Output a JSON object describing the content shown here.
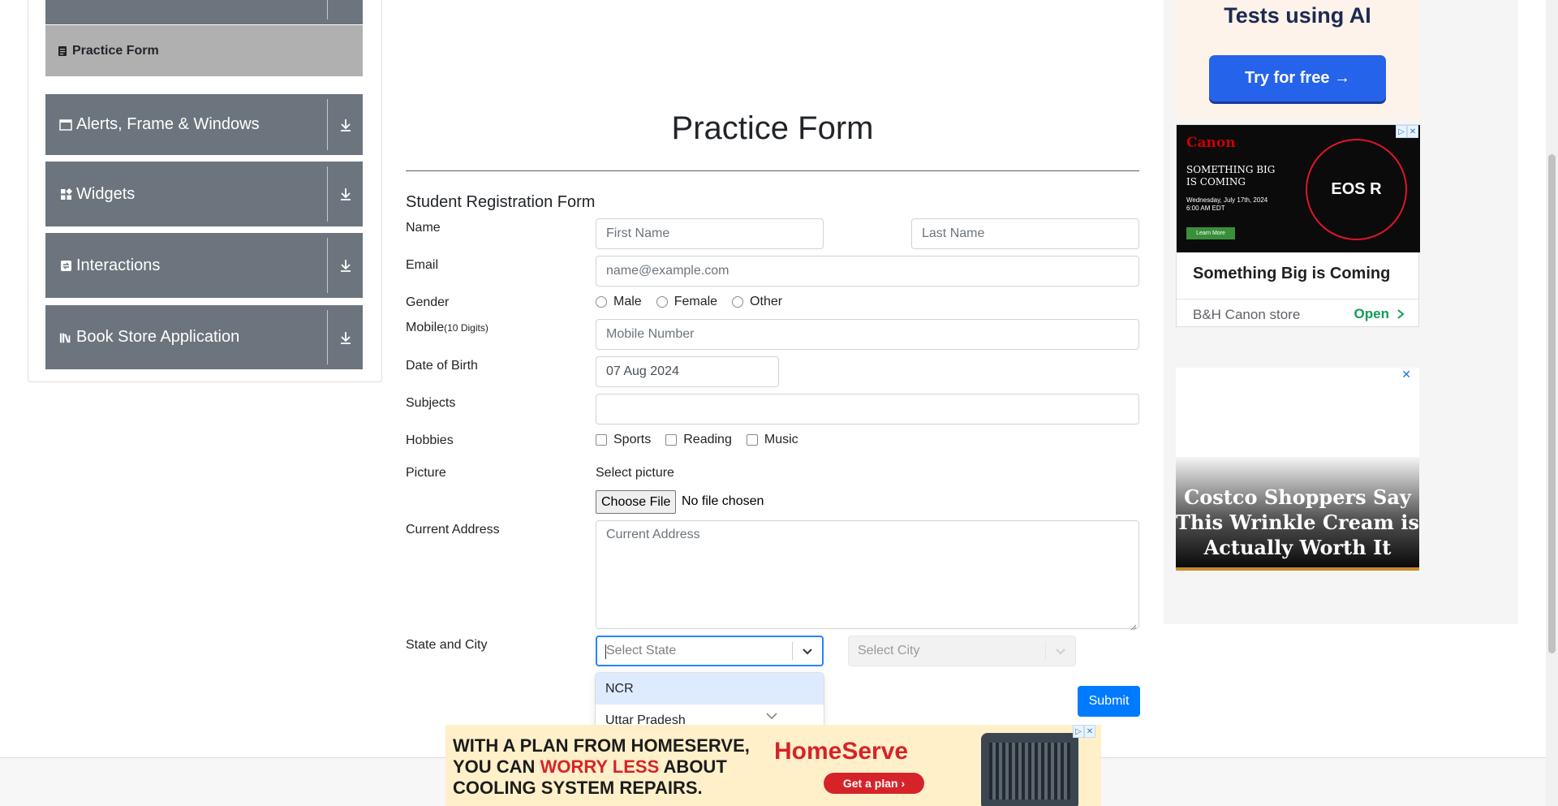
{
  "sidebar": {
    "active_item": {
      "label": "Practice Form",
      "icon": "form-icon"
    },
    "groups": [
      {
        "label": "Alerts, Frame & Windows",
        "icon": "window-icon"
      },
      {
        "label": "Widgets",
        "icon": "widgets-icon"
      },
      {
        "label": "Interactions",
        "icon": "interactions-icon"
      },
      {
        "label": "Book Store Application",
        "icon": "books-icon"
      }
    ]
  },
  "form": {
    "page_title": "Practice Form",
    "subtitle": "Student Registration Form",
    "name": {
      "label": "Name",
      "first_placeholder": "First Name",
      "last_placeholder": "Last Name"
    },
    "email": {
      "label": "Email",
      "placeholder": "name@example.com"
    },
    "gender": {
      "label": "Gender",
      "options": [
        "Male",
        "Female",
        "Other"
      ]
    },
    "mobile": {
      "label": "Mobile",
      "hint": "(10 Digits)",
      "placeholder": "Mobile Number"
    },
    "dob": {
      "label": "Date of Birth",
      "value": "07 Aug 2024"
    },
    "subjects": {
      "label": "Subjects",
      "value": ""
    },
    "hobbies": {
      "label": "Hobbies",
      "options": [
        "Sports",
        "Reading",
        "Music"
      ]
    },
    "picture": {
      "label": "Picture",
      "select_text": "Select picture",
      "button": "Choose File",
      "status": "No file chosen"
    },
    "address": {
      "label": "Current Address",
      "placeholder": "Current Address"
    },
    "state_city": {
      "label": "State and City",
      "state_placeholder": "Select State",
      "city_placeholder": "Select City",
      "state_options": [
        "NCR",
        "Uttar Pradesh"
      ]
    },
    "submit": "Submit"
  },
  "ads": {
    "top": {
      "heading": "Tests using AI",
      "cta": "Try for free →"
    },
    "canon": {
      "brand": "Canon",
      "tagline": "SOMETHING BIG IS COMING",
      "date": "Wednesday, July 17th, 2024 6:00 AM EDT",
      "learn": "Learn More",
      "product": "EOS R",
      "headline": "Something Big is Coming",
      "store": "B&H Canon store",
      "open": "Open"
    },
    "costco": {
      "text": "Costco Shoppers Say This Wrinkle Cream is Actually Worth It",
      "close": "✕"
    },
    "banner": {
      "line1": "WITH A PLAN FROM HOMESERVE,",
      "line2_pre": "YOU CAN ",
      "line2_accent": "WORRY LESS",
      "line2_post": " ABOUT",
      "line3": "COOLING SYSTEM REPAIRS.",
      "brand": "HomeServe",
      "cta": "Get a plan ›"
    }
  },
  "colors": {
    "sidebar_group": "#6c757d",
    "sidebar_active": "#b0b0b0",
    "primary": "#007bff",
    "focus_border": "#2684ff",
    "option_focus": "#deebff"
  }
}
